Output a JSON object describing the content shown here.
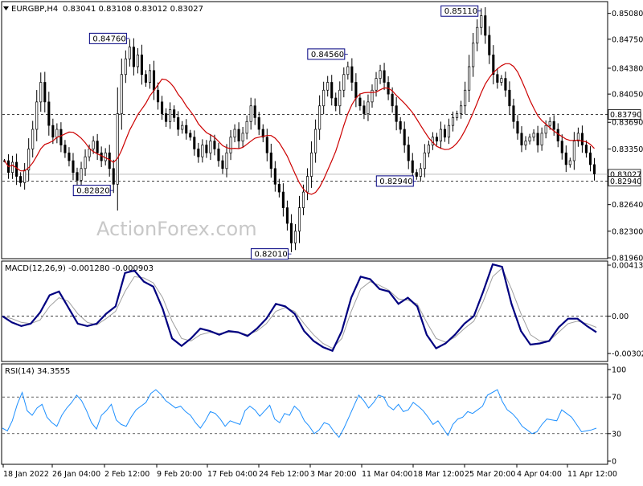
{
  "chart_data": {
    "type": "candlestick",
    "symbol_label": "EURGBP,H4",
    "ohlc_label": "0.83041 0.83108 0.83012 0.83027",
    "watermark": "ActionForex.com",
    "colors": {
      "candles": "#000000",
      "ma": "#cc0000",
      "macd": "#000080",
      "signal": "#a0a0a0",
      "rsi": "#1e90ff",
      "levels": "#000000"
    },
    "x_ticks": [
      "18 Jan 2022",
      "26 Jan 04:00",
      "2 Feb 12:00",
      "9 Feb 20:00",
      "17 Feb 04:00",
      "24 Feb 12:00",
      "3 Mar 20:00",
      "11 Mar 04:00",
      "18 Mar 12:00",
      "25 Mar 20:00",
      "4 Apr 04:00",
      "11 Apr 12:00"
    ],
    "price_panel": {
      "ylim": [
        0.8196,
        0.8522
      ],
      "y_ticks": [
        "0.85080",
        "0.84750",
        "0.84380",
        "0.84050",
        "0.83690",
        "0.83350",
        "0.82640",
        "0.82300",
        "0.81960"
      ],
      "current_price": "0.83027",
      "dashed_levels": [
        "0.83790",
        "0.82940"
      ],
      "annotations": [
        "0.84760",
        "0.82820",
        "0.82010",
        "0.84560",
        "0.82940",
        "0.85110"
      ],
      "closes": [
        0.832,
        0.8305,
        0.8318,
        0.83,
        0.8292,
        0.8308,
        0.8335,
        0.836,
        0.8395,
        0.842,
        0.8395,
        0.8365,
        0.835,
        0.836,
        0.834,
        0.833,
        0.832,
        0.8305,
        0.8295,
        0.831,
        0.8325,
        0.8335,
        0.8345,
        0.833,
        0.832,
        0.833,
        0.831,
        0.829,
        0.838,
        0.843,
        0.845,
        0.8465,
        0.844,
        0.8455,
        0.843,
        0.842,
        0.8435,
        0.841,
        0.8395,
        0.838,
        0.837,
        0.8385,
        0.8375,
        0.836,
        0.8365,
        0.8355,
        0.835,
        0.8335,
        0.8325,
        0.834,
        0.833,
        0.8345,
        0.8335,
        0.832,
        0.831,
        0.833,
        0.835,
        0.836,
        0.8345,
        0.8355,
        0.837,
        0.839,
        0.8375,
        0.836,
        0.835,
        0.833,
        0.831,
        0.829,
        0.828,
        0.826,
        0.824,
        0.8215,
        0.823,
        0.826,
        0.828,
        0.83,
        0.833,
        0.836,
        0.839,
        0.841,
        0.842,
        0.84,
        0.839,
        0.841,
        0.843,
        0.844,
        0.842,
        0.84,
        0.839,
        0.838,
        0.8395,
        0.841,
        0.8425,
        0.8435,
        0.842,
        0.8405,
        0.839,
        0.837,
        0.836,
        0.834,
        0.832,
        0.8305,
        0.83,
        0.831,
        0.833,
        0.834,
        0.835,
        0.8345,
        0.836,
        0.835,
        0.8365,
        0.8375,
        0.838,
        0.839,
        0.841,
        0.844,
        0.847,
        0.849,
        0.8505,
        0.848,
        0.8455,
        0.843,
        0.842,
        0.8425,
        0.841,
        0.839,
        0.837,
        0.8355,
        0.834,
        0.8345,
        0.835,
        0.8355,
        0.834,
        0.8355,
        0.8365,
        0.837,
        0.836,
        0.8345,
        0.833,
        0.8315,
        0.832,
        0.8345,
        0.8355,
        0.834,
        0.833,
        0.8315,
        0.8303
      ]
    },
    "macd_panel": {
      "label": "MACD(12,26,9) -0.001280 -0.000903",
      "ylim": [
        -0.0036,
        0.0044
      ],
      "y_ticks": [
        "0.004138",
        "0.00",
        "-0.00302"
      ],
      "macd": [
        0.0,
        -0.0005,
        -0.0008,
        -0.0006,
        0.0003,
        0.0017,
        0.002,
        0.0007,
        -0.0006,
        -0.0008,
        -0.0006,
        0.0002,
        0.0008,
        0.0035,
        0.0037,
        0.0028,
        0.0024,
        0.0006,
        -0.0018,
        -0.0024,
        -0.0018,
        -0.001,
        -0.0012,
        -0.0015,
        -0.0012,
        -0.0013,
        -0.0016,
        -0.001,
        -0.0002,
        0.001,
        0.0008,
        0.0002,
        -0.0012,
        -0.002,
        -0.0025,
        -0.0028,
        -0.0012,
        0.0015,
        0.0032,
        0.003,
        0.0022,
        0.002,
        0.001,
        0.0015,
        0.0008,
        -0.0015,
        -0.0026,
        -0.0022,
        -0.0015,
        -0.0006,
        0.0,
        0.002,
        0.0042,
        0.004,
        0.001,
        -0.0012,
        -0.0023,
        -0.0022,
        -0.002,
        -0.0009,
        -0.0002,
        -0.0002,
        -0.0008,
        -0.0013
      ],
      "signal": [
        0.0,
        -0.0002,
        -0.0005,
        -0.0006,
        -0.0003,
        0.0008,
        0.0015,
        0.0012,
        0.0002,
        -0.0005,
        -0.0007,
        -0.0002,
        0.0004,
        0.002,
        0.0032,
        0.0031,
        0.0027,
        0.0015,
        -0.0004,
        -0.0018,
        -0.002,
        -0.0015,
        -0.0013,
        -0.0014,
        -0.0013,
        -0.0013,
        -0.0015,
        -0.0012,
        -0.0006,
        0.0004,
        0.0007,
        0.0004,
        -0.0006,
        -0.0015,
        -0.0022,
        -0.0026,
        -0.0018,
        0.0004,
        0.0022,
        0.0028,
        0.0025,
        0.0021,
        0.0014,
        0.0013,
        0.001,
        -0.0005,
        -0.0018,
        -0.0021,
        -0.0017,
        -0.001,
        -0.0004,
        0.0012,
        0.0032,
        0.0039,
        0.0022,
        0.0002,
        -0.0015,
        -0.002,
        -0.002,
        -0.0013,
        -0.0006,
        -0.0004,
        -0.0006,
        -0.0009
      ]
    },
    "rsi_panel": {
      "label": "RSI(14) 34.3555",
      "ylim": [
        0,
        100
      ],
      "y_ticks": [
        "100",
        "70",
        "30",
        "0"
      ],
      "levels": [
        70,
        30
      ],
      "values": [
        36,
        33,
        44,
        62,
        75,
        55,
        50,
        58,
        62,
        48,
        42,
        38,
        50,
        58,
        64,
        72,
        66,
        55,
        42,
        35,
        50,
        55,
        62,
        45,
        40,
        38,
        48,
        56,
        60,
        64,
        74,
        78,
        73,
        66,
        62,
        58,
        60,
        54,
        50,
        42,
        36,
        44,
        54,
        52,
        46,
        38,
        44,
        42,
        40,
        55,
        60,
        56,
        49,
        55,
        61,
        46,
        42,
        52,
        50,
        60,
        55,
        44,
        38,
        30,
        34,
        42,
        40,
        32,
        26,
        36,
        48,
        60,
        72,
        66,
        58,
        64,
        72,
        70,
        60,
        56,
        62,
        54,
        56,
        64,
        60,
        55,
        48,
        40,
        44,
        36,
        28,
        40,
        46,
        48,
        54,
        52,
        56,
        60,
        72,
        75,
        78,
        65,
        56,
        52,
        46,
        38,
        34,
        30,
        32,
        40,
        46,
        45,
        44,
        56,
        52,
        48,
        40,
        32,
        33,
        34,
        36
      ],
      "current": 34.3555
    }
  }
}
